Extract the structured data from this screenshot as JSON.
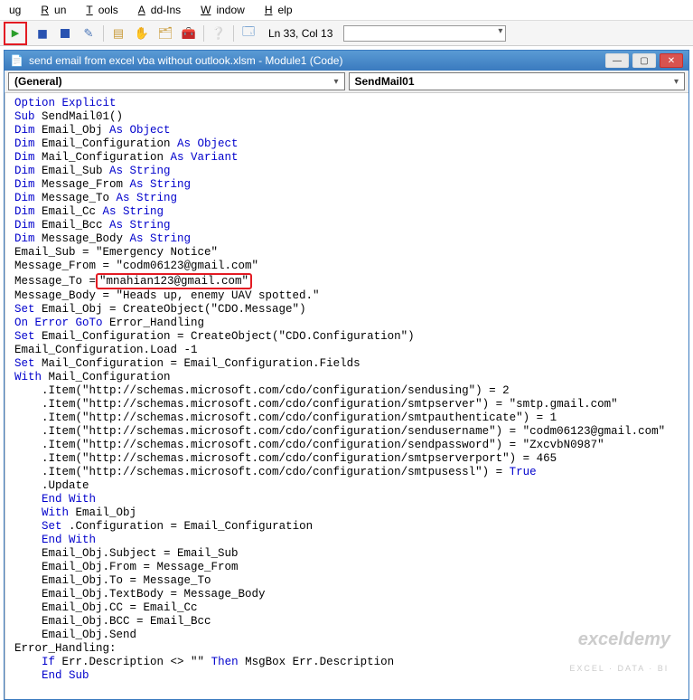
{
  "menu": {
    "items": [
      "ug",
      "Run",
      "Tools",
      "Add-Ins",
      "Window",
      "Help"
    ]
  },
  "toolbar": {
    "cursor_position": "Ln 33, Col 13"
  },
  "window": {
    "title": "send email from excel vba without outlook.xlsm - Module1 (Code)"
  },
  "selectors": {
    "left": "(General)",
    "right": "SendMail01"
  },
  "code": {
    "l1_1": "Option Explicit",
    "l2_1": "Sub",
    "l2_2": " SendMail01()",
    "l3_1": "Dim",
    "l3_2": " Email_Obj ",
    "l3_3": "As Object",
    "l4_1": "Dim",
    "l4_2": " Email_Configuration ",
    "l4_3": "As Object",
    "l5_1": "Dim",
    "l5_2": " Mail_Configuration ",
    "l5_3": "As Variant",
    "l6_1": "Dim",
    "l6_2": " Email_Sub ",
    "l6_3": "As String",
    "l7_1": "Dim",
    "l7_2": " Message_From ",
    "l7_3": "As String",
    "l8_1": "Dim",
    "l8_2": " Message_To ",
    "l8_3": "As String",
    "l9_1": "Dim",
    "l9_2": " Email_Cc ",
    "l9_3": "As String",
    "l10_1": "Dim",
    "l10_2": " Email_Bcc ",
    "l10_3": "As String",
    "l11_1": "Dim",
    "l11_2": " Message_Body ",
    "l11_3": "As String",
    "l12": "Email_Sub = \"Emergency Notice\"",
    "l13": "Message_From = \"codm06123@gmail.com\"",
    "l14a": "Message_To =",
    "l14b": "\"mnahian123@gmail.com\"",
    "l15": "Message_Body = \"Heads up, enemy UAV spotted.\"",
    "l16_1": "Set",
    "l16_2": " Email_Obj = CreateObject(\"CDO.Message\")",
    "l17_1": "On Error GoTo",
    "l17_2": " Error_Handling",
    "l18_1": "Set",
    "l18_2": " Email_Configuration = CreateObject(\"CDO.Configuration\")",
    "l19": "Email_Configuration.Load -1",
    "l20_1": "Set",
    "l20_2": " Mail_Configuration = Email_Configuration.Fields",
    "l21_1": "With",
    "l21_2": " Mail_Configuration",
    "l22": "    .Item(\"http://schemas.microsoft.com/cdo/configuration/sendusing\") = 2",
    "l23": "    .Item(\"http://schemas.microsoft.com/cdo/configuration/smtpserver\") = \"smtp.gmail.com\"",
    "l24": "    .Item(\"http://schemas.microsoft.com/cdo/configuration/smtpauthenticate\") = 1",
    "l25": "    .Item(\"http://schemas.microsoft.com/cdo/configuration/sendusername\") = \"codm06123@gmail.com\"",
    "l26": "    .Item(\"http://schemas.microsoft.com/cdo/configuration/sendpassword\") = \"ZxcvbN0987\"",
    "l27": "    .Item(\"http://schemas.microsoft.com/cdo/configuration/smtpserverport\") = 465",
    "l28a": "    .Item(\"http://schemas.microsoft.com/cdo/configuration/smtpusessl\") = ",
    "l28b": "True",
    "l29": "    .Update",
    "l30": "    ",
    "l30_1": "End With",
    "l31": "    ",
    "l31_1": "With",
    "l31_2": " Email_Obj",
    "l32": "    ",
    "l32_1": "Set",
    "l32_2": " .Configuration = Email_Configuration",
    "l33": "    ",
    "l33_1": "End With",
    "l34": "    Email_Obj.Subject = Email_Sub",
    "l35": "    Email_Obj.From = Message_From",
    "l36": "    Email_Obj.To = Message_To",
    "l37": "    Email_Obj.TextBody = Message_Body",
    "l38": "    Email_Obj.CC = Email_Cc",
    "l39": "    Email_Obj.BCC = Email_Bcc",
    "l40": "    Email_Obj.Send",
    "l41": "Error_Handling:",
    "l42_1": "    ",
    "l42_2": "If",
    "l42_3": " Err.Description <> \"\" ",
    "l42_4": "Then",
    "l42_5": " MsgBox Err.Description",
    "l43": "    ",
    "l43_1": "End Sub"
  },
  "watermark": {
    "main": "exceldemy",
    "sub": "EXCEL · DATA · BI"
  }
}
